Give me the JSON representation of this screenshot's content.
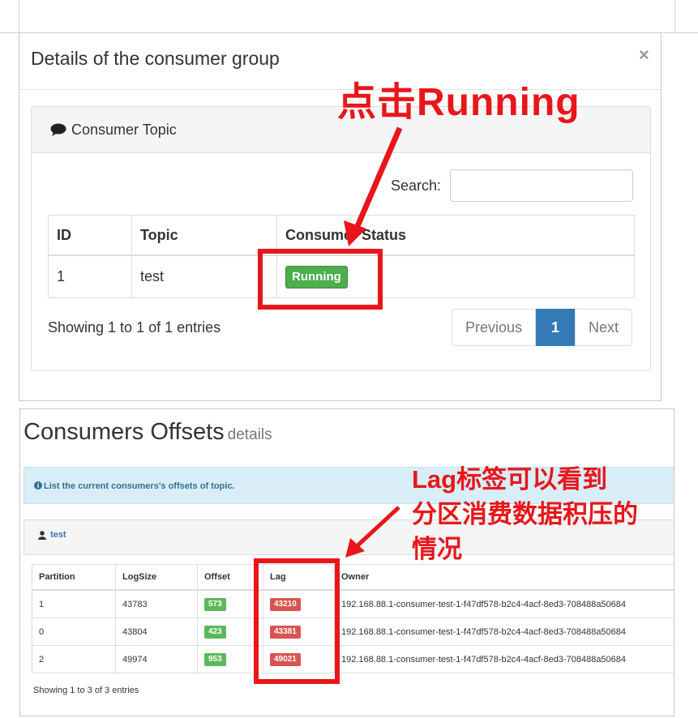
{
  "modal": {
    "title": "Details of the consumer group",
    "close_symbol": "×",
    "panel_heading": "Consumer Topic",
    "search_label": "Search:",
    "search_value": "",
    "table": {
      "headers": [
        "ID",
        "Topic",
        "Consumer Status"
      ],
      "rows": [
        {
          "id": "1",
          "topic": "test",
          "status": "Running"
        }
      ]
    },
    "showing_text": "Showing 1 to 1 of 1 entries",
    "pagination": {
      "previous": "Previous",
      "current": "1",
      "next": "Next"
    }
  },
  "offsets": {
    "title": "Consumers Offsets",
    "title_small": "details",
    "info_text": "List the current consumers's offsets of topic.",
    "topic_panel": "test",
    "table": {
      "headers": [
        "Partition",
        "LogSize",
        "Offset",
        "Lag",
        "Owner"
      ],
      "rows": [
        {
          "partition": "1",
          "logsize": "43783",
          "offset": "573",
          "lag": "43210",
          "owner": "192.168.88.1-consumer-test-1-f47df578-b2c4-4acf-8ed3-708488a50684"
        },
        {
          "partition": "0",
          "logsize": "43804",
          "offset": "423",
          "lag": "43381",
          "owner": "192.168.88.1-consumer-test-1-f47df578-b2c4-4acf-8ed3-708488a50684"
        },
        {
          "partition": "2",
          "logsize": "49974",
          "offset": "953",
          "lag": "49021",
          "owner": "192.168.88.1-consumer-test-1-f47df578-b2c4-4acf-8ed3-708488a50684"
        }
      ]
    },
    "showing_text": "Showing 1 to 3 of 3 entries"
  },
  "annotations": {
    "click_running": "点击Running",
    "lag_note_line1": "Lag标签可以看到",
    "lag_note_line2": "分区消费数据积压的",
    "lag_note_line3": "情况",
    "color": "#e8161b"
  },
  "colors": {
    "running_badge": "#4cae4c",
    "pagination_active": "#337ab7",
    "offset_label": "#5cb85c",
    "lag_label": "#d9534f",
    "info_bg": "#d9edf7"
  }
}
